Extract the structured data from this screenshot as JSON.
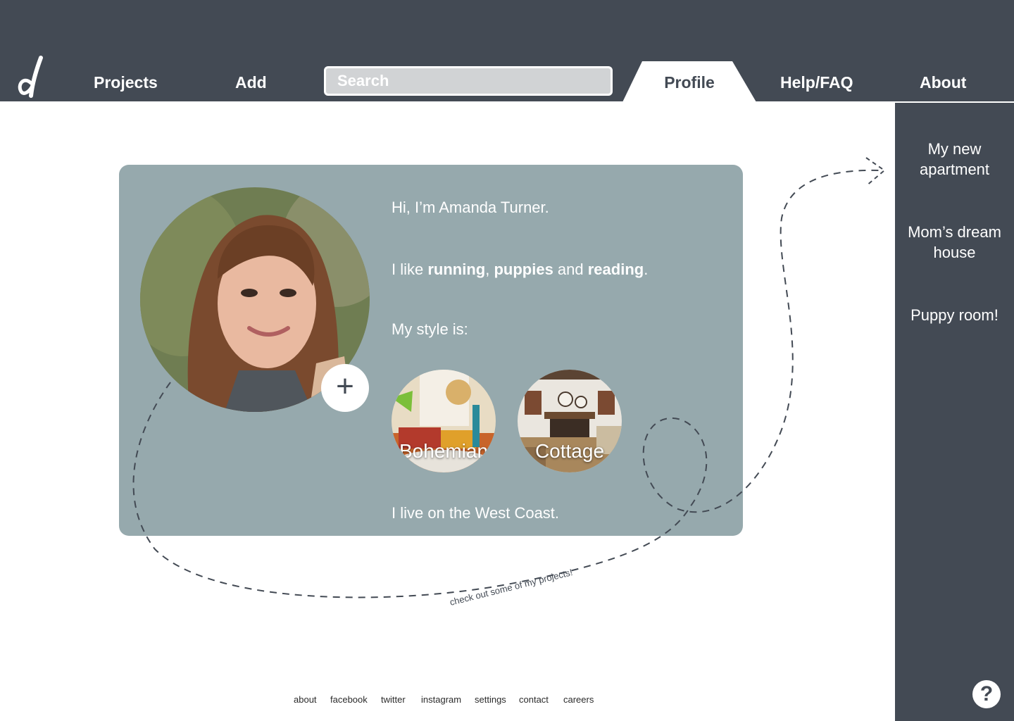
{
  "nav": {
    "logo_letter": "d",
    "projects": "Projects",
    "add": "Add",
    "search_placeholder": "Search",
    "profile": "Profile",
    "help": "Help/FAQ",
    "about": "About"
  },
  "profile": {
    "greeting": "Hi, I’m Amanda Turner.",
    "likes_prefix": "I like ",
    "like1": "running",
    "comma": ", ",
    "like2": "puppies",
    "and": " and ",
    "like3": "reading",
    "period": ".",
    "style_heading": "My style is:",
    "styles": [
      {
        "label": "Bohemian"
      },
      {
        "label": "Cottage"
      }
    ],
    "location": "I live on the West Coast."
  },
  "annotation": "check out some of my projects!",
  "sidebar": {
    "items": [
      {
        "label": "My new apartment"
      },
      {
        "label": "Mom’s dream house"
      },
      {
        "label": "Puppy room!"
      }
    ],
    "help_symbol": "?"
  },
  "footer": [
    "about",
    "facebook",
    "twitter",
    "instagram",
    "settings",
    "contact",
    "careers"
  ],
  "colors": {
    "header": "#434a54",
    "card": "#96a9ad",
    "search_fill": "#d1d3d5"
  }
}
